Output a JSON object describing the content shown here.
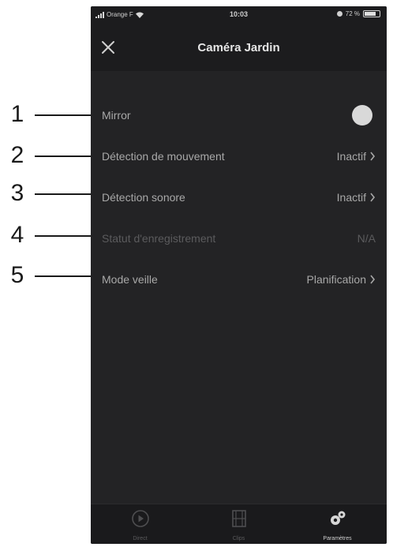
{
  "callouts": [
    "1",
    "2",
    "3",
    "4",
    "5"
  ],
  "status_bar": {
    "carrier": "Orange F",
    "time": "10:03",
    "battery": "72 %"
  },
  "header": {
    "title": "Caméra Jardin",
    "close_icon": "close-icon"
  },
  "settings": [
    {
      "label": "Mirror",
      "value": "",
      "control": "toggle",
      "state": "on"
    },
    {
      "label": "Détection de mouvement",
      "value": "Inactif",
      "control": "chevron"
    },
    {
      "label": "Détection sonore",
      "value": "Inactif",
      "control": "chevron"
    },
    {
      "label": "Statut d'enregistrement",
      "value": "N/A",
      "control": "none",
      "disabled": true
    },
    {
      "label": "Mode veille",
      "value": "Planification",
      "control": "chevron"
    }
  ],
  "tab_bar": {
    "tabs": [
      {
        "label": "Direct",
        "icon": "live-play-icon",
        "active": false
      },
      {
        "label": "Clips",
        "icon": "film-icon",
        "active": false
      },
      {
        "label": "Paramètres",
        "icon": "gears-icon",
        "active": true
      }
    ]
  },
  "colors": {
    "background": "#232325",
    "bar": "#1c1c1e",
    "text": "#a8a8a8",
    "title": "#e6e6e6"
  }
}
